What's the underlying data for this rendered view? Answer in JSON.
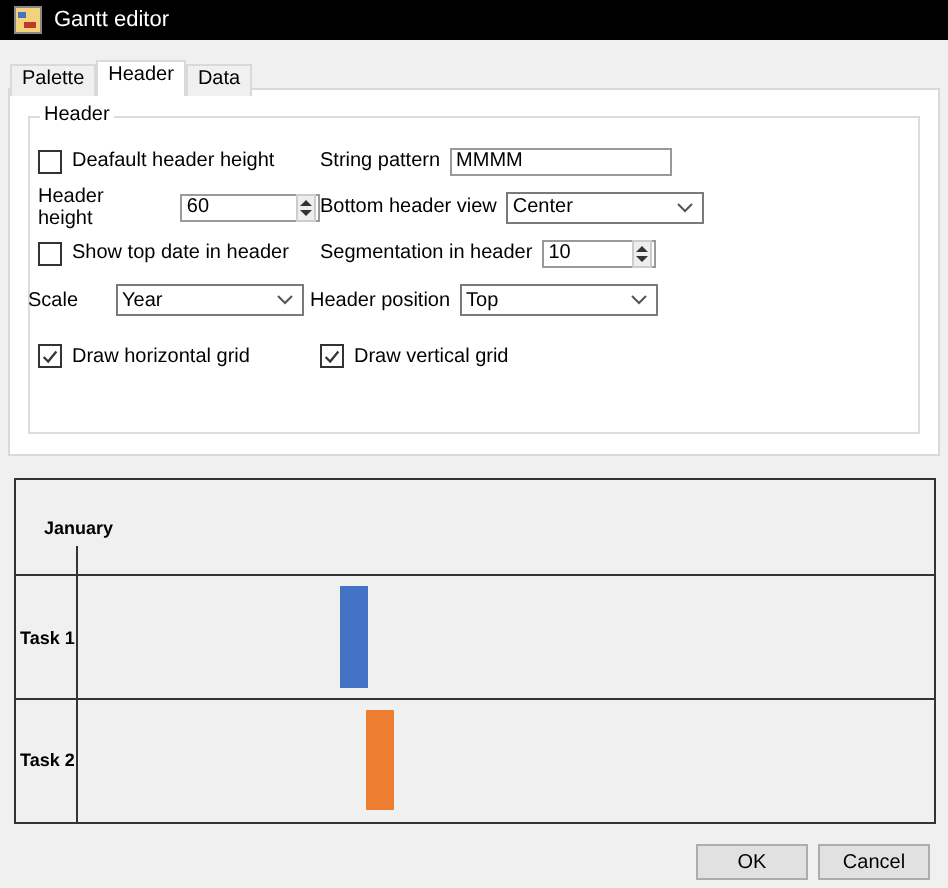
{
  "window": {
    "title": "Gantt editor"
  },
  "tabs": [
    {
      "label": "Palette",
      "selected": false
    },
    {
      "label": "Header",
      "selected": true
    },
    {
      "label": "Data",
      "selected": false
    }
  ],
  "group": {
    "title": "Header",
    "rows": [
      {
        "left": {
          "kind": "checkbox",
          "label": "Deafault header height",
          "checked": false
        },
        "right": {
          "kind": "text",
          "label": "String pattern",
          "value": "MMMM"
        }
      },
      {
        "left": {
          "kind": "spinner",
          "label": "Header height",
          "value": "60"
        },
        "right": {
          "kind": "dropdown",
          "label": "Bottom header view",
          "value": "Center"
        }
      },
      {
        "left": {
          "kind": "checkbox",
          "label": "Show top date in header",
          "checked": false
        },
        "right": {
          "kind": "spinner",
          "label": "Segmentation in header",
          "value": "10"
        }
      },
      {
        "left": {
          "kind": "dropdown",
          "label": "Scale",
          "value": "Year"
        },
        "right": {
          "kind": "dropdown",
          "label": "Header position",
          "value": "Top"
        }
      },
      {
        "left": {
          "kind": "checkbox",
          "label": "Draw horizontal grid",
          "checked": true
        },
        "right": {
          "kind": "checkbox",
          "label": "Draw vertical grid",
          "checked": true
        }
      }
    ]
  },
  "gantt": {
    "header": "January",
    "tasks": [
      {
        "name": "Task 1",
        "color": "#4472c4"
      },
      {
        "name": "Task 2",
        "color": "#ed7d31"
      }
    ]
  },
  "buttons": [
    "OK",
    "Cancel"
  ]
}
